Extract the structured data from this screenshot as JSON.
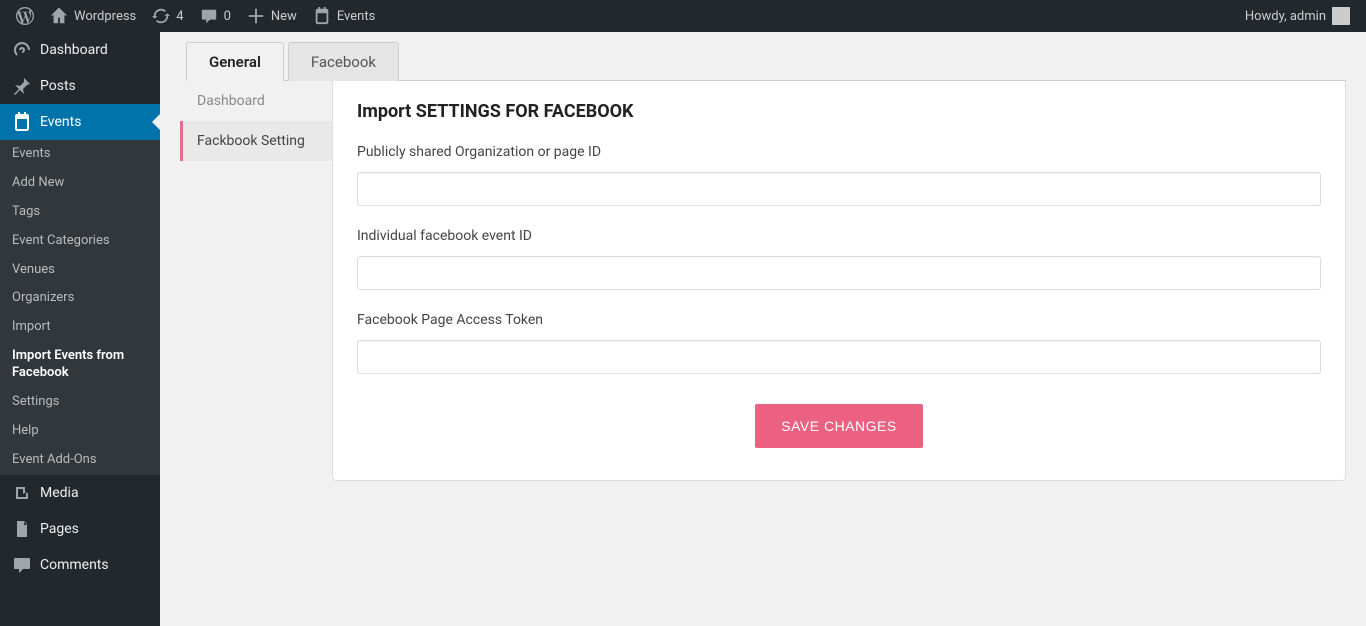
{
  "adminbar": {
    "site_name": "Wordpress",
    "updates_count": "4",
    "comments_count": "0",
    "new_label": "New",
    "events_label": "Events",
    "greeting": "Howdy, admin"
  },
  "sidemenu": {
    "dashboard": "Dashboard",
    "posts": "Posts",
    "events": "Events",
    "events_sub": {
      "events": "Events",
      "add_new": "Add New",
      "tags": "Tags",
      "event_categories": "Event Categories",
      "venues": "Venues",
      "organizers": "Organizers",
      "import": "Import",
      "import_fb": "Import Events from Facebook",
      "settings": "Settings",
      "help": "Help",
      "event_addons": "Event Add-Ons"
    },
    "media": "Media",
    "pages": "Pages",
    "comments": "Comments"
  },
  "tabs": {
    "general": "General",
    "facebook": "Facebook"
  },
  "subtabs": {
    "dashboard": "Dashboard",
    "fb_setting": "Fackbook Setting"
  },
  "form": {
    "heading": "Import SETTINGS FOR FACEBOOK",
    "org_label": "Publicly shared Organization or page ID",
    "org_value": "",
    "event_id_label": "Individual facebook event ID",
    "event_id_value": "",
    "token_label": "Facebook Page Access Token",
    "token_value": "",
    "save_label": "SAVE CHANGES"
  }
}
